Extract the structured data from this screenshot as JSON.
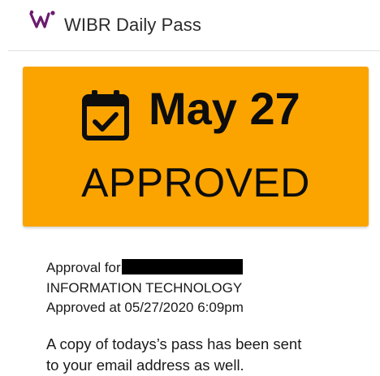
{
  "app": {
    "title": "WIBR Daily Pass",
    "logo_icon": "wibr-logo-icon",
    "brand_color": "#6a1b6e"
  },
  "pass": {
    "icon": "calendar-check-icon",
    "date": "May 27",
    "status": "APPROVED",
    "card_color": "#fba400"
  },
  "details": {
    "approval_for_label": "Approval for",
    "department": "INFORMATION TECHNOLOGY",
    "approved_at": "Approved at 05/27/2020 6:09pm"
  },
  "note": {
    "line1": "A copy of todays’s pass has been sent",
    "line2": "to your email address as well."
  }
}
